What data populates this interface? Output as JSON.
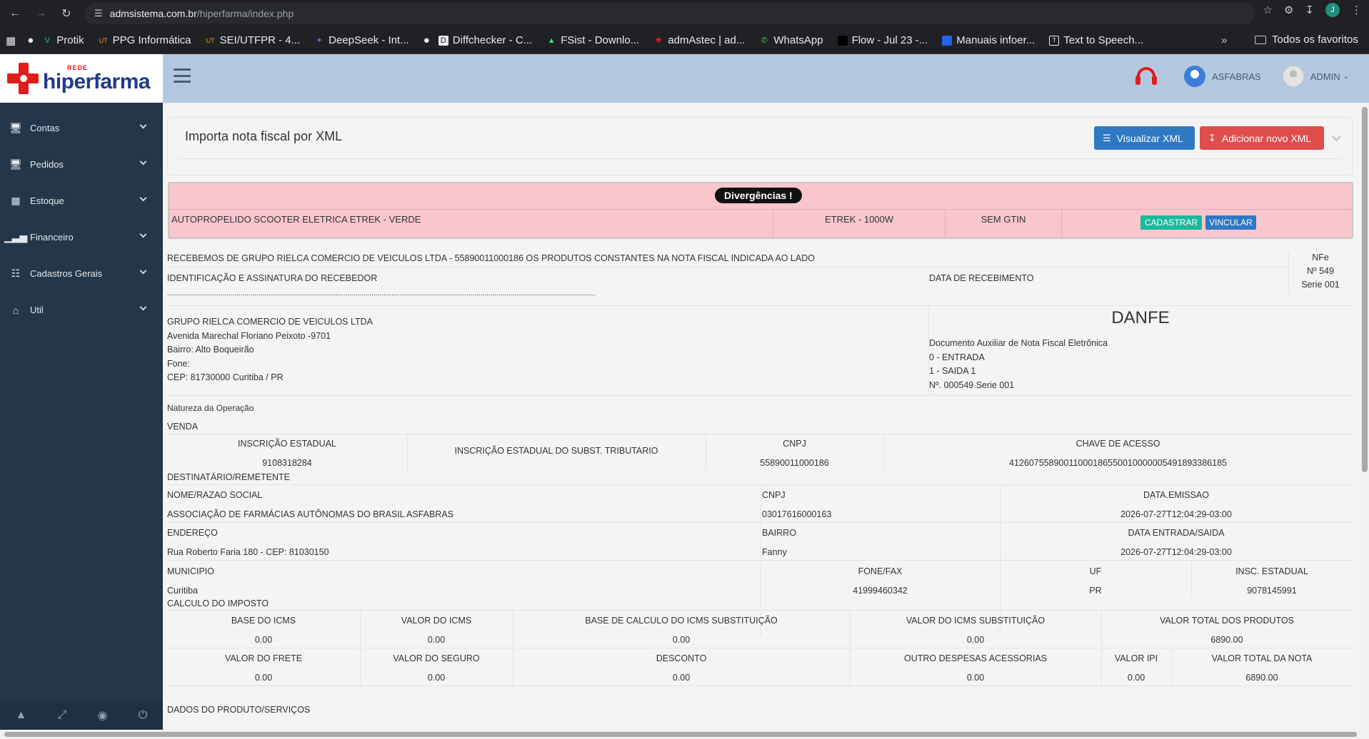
{
  "browser": {
    "url_host": "admsistema.com.br",
    "url_path": "/hiperfarma/index.php",
    "profile_initial": "J",
    "bookmarks": [
      "Protik",
      "PPG Informática",
      "SEI/UTFPR - 4...",
      "DeepSeek - Int...",
      "Diffchecker - C...",
      "FSist - Downlo...",
      "admAstec | ad...",
      "WhatsApp",
      "Flow - Jul 23 -...",
      "Manuais infoer...",
      "Text to Speech..."
    ],
    "more": "»",
    "all_bookmarks": "Todos os favoritos"
  },
  "brand": {
    "rede": "REDE",
    "name": "hiperfarma"
  },
  "header": {
    "org": "ASFABRAS",
    "user": "ADMIN"
  },
  "sidebar": {
    "items": [
      {
        "label": "Contas",
        "icon": "monitor-icon"
      },
      {
        "label": "Pedidos",
        "icon": "monitor-icon"
      },
      {
        "label": "Estoque",
        "icon": "table-icon"
      },
      {
        "label": "Financeiro",
        "icon": "bar-chart-icon"
      },
      {
        "label": "Cadastros Gerais",
        "icon": "sitemap-icon"
      },
      {
        "label": "Util",
        "icon": "home-icon"
      }
    ]
  },
  "panel": {
    "title": "Importa nota fiscal por XML",
    "btn_view": "Visualizar XML",
    "btn_add": "Adicionar novo XML"
  },
  "divergencias": {
    "badge": "Divergências !",
    "product": "AUTOPROPELIDO SCOOTER ELETRICA ETREK - VERDE",
    "model": "ETREK - 1000W",
    "gtin": "SEM GTIN",
    "btn_register": "CADASTRAR",
    "btn_link": "VINCULAR"
  },
  "danfe": {
    "receipt": "RECEBEMOS DE GRUPO RIELCA COMERCIO DE VEICULOS LTDA - 55890011000186 OS PRODUTOS CONSTANTES NA NOTA FISCAL INDICADA AO LADO",
    "id_sign": "IDENTIFICAÇÃO E ASSINATURA DO RECEBEDOR",
    "date_received": "DATA DE RECEBIMENTO",
    "nfe": "NFe",
    "nfe_number": "Nº 549",
    "nfe_serie": "Serie 001",
    "dots": "........................................................................................................................................................................................................................",
    "emitter": {
      "name": "GRUPO RIELCA COMERCIO DE VEICULOS LTDA",
      "address": "Avenida Marechal Floriano Peixoto -9701",
      "district": "Bairro: Alto Boqueirão",
      "phone": "Fone:",
      "cep": "CEP: 81730000 Curitiba / PR"
    },
    "title": "DANFE",
    "doc_aux": "Documento Auxiliar de Nota Fiscal Eletrônica",
    "entrada": "0 - ENTRADA",
    "saida": "1 - SAIDA 1",
    "number": "Nº. 000549 Serie 001",
    "natureza_label": "Natureza da Operação",
    "natureza": "VENDA",
    "ie_label": "INSCRIÇÃO ESTADUAL",
    "ie": "9108318284",
    "ie_st_label": "INSCRIÇÃO ESTADUAL DO SUBST. TRIBUTARIO",
    "cnpj_label": "CNPJ",
    "cnpj": "55890011000186",
    "chave_label": "CHAVE DE ACESSO",
    "chave": "41260755890011000186550010000005491893386185",
    "dest_label": "DESTINATÁRIO/REMETENTE",
    "razao_label": "NOME/RAZAO SOCIAL",
    "razao": "ASSOCIAÇÃO DE FARMÁCIAS AUTÔNOMAS DO BRASIL ASFABRAS",
    "dest_cnpj_label": "CNPJ",
    "dest_cnpj": "03017616000163",
    "emissao_label": "DATA.EMISSAO",
    "emissao": "2026-07-27T12:04:29-03:00",
    "endereco_label": "ENDEREÇO",
    "endereco": "Rua Roberto Faria 180 - CEP: 81030150",
    "bairro_label": "BAIRRO",
    "bairro": "Fanny",
    "entrada_saida_label": "DATA ENTRADA/SAIDA",
    "entrada_saida": "2026-07-27T12:04:29-03:00",
    "municipio_label": "MUNICIPIO",
    "municipio": "Curitiba",
    "fone_label": "FONE/FAX",
    "fone": "41999460342",
    "uf_label": "UF",
    "uf": "PR",
    "insc_label": "INSC. ESTADUAL",
    "insc": "9078145991",
    "imposto_label": "CALCULO DO IMPOSTO",
    "tax_row1": [
      {
        "label": "BASE DO ICMS",
        "value": "0.00"
      },
      {
        "label": "VALOR DO ICMS",
        "value": "0.00"
      },
      {
        "label": "BASE DE CALCULO DO ICMS SUBSTITUIÇÃO",
        "value": "0.00"
      },
      {
        "label": "VALOR DO ICMS SUBSTITUIÇÃO",
        "value": "0.00"
      },
      {
        "label": "VALOR TOTAL DOS PRODUTOS",
        "value": "6890.00"
      }
    ],
    "tax_row2": [
      {
        "label": "VALOR DO FRETE",
        "value": "0.00"
      },
      {
        "label": "VALOR DO SEGURO",
        "value": "0.00"
      },
      {
        "label": "DESCONTO",
        "value": "0.00"
      },
      {
        "label": "OUTRO DESPESAS ACESSORIAS",
        "value": "0.00"
      },
      {
        "label": "VALOR IPI",
        "value": "0.00"
      },
      {
        "label": "VALOR TOTAL DA NOTA",
        "value": "6890.00"
      }
    ],
    "produtos_label": "DADOS DO PRODUTO/SERVIÇOS"
  }
}
